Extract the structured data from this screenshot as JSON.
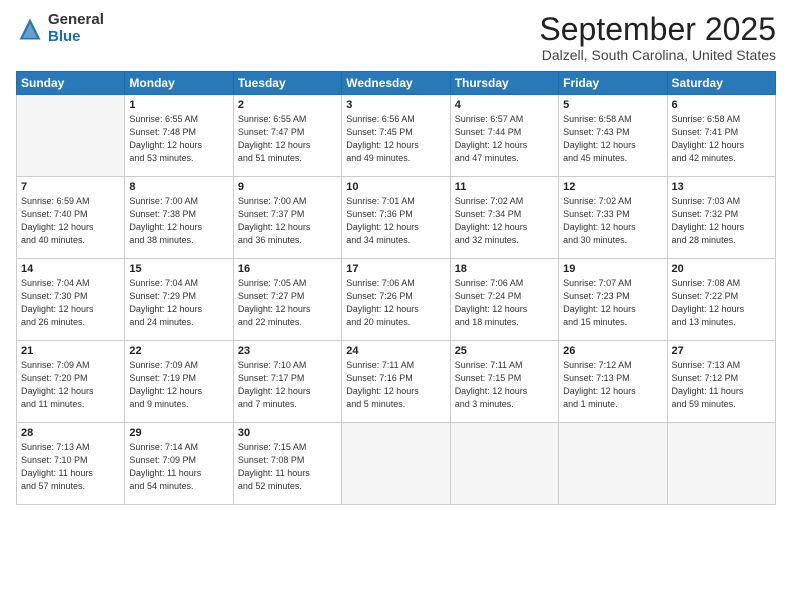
{
  "header": {
    "logo_general": "General",
    "logo_blue": "Blue",
    "month": "September 2025",
    "location": "Dalzell, South Carolina, United States"
  },
  "weekdays": [
    "Sunday",
    "Monday",
    "Tuesday",
    "Wednesday",
    "Thursday",
    "Friday",
    "Saturday"
  ],
  "weeks": [
    [
      {
        "day": "",
        "info": ""
      },
      {
        "day": "1",
        "info": "Sunrise: 6:55 AM\nSunset: 7:48 PM\nDaylight: 12 hours\nand 53 minutes."
      },
      {
        "day": "2",
        "info": "Sunrise: 6:55 AM\nSunset: 7:47 PM\nDaylight: 12 hours\nand 51 minutes."
      },
      {
        "day": "3",
        "info": "Sunrise: 6:56 AM\nSunset: 7:45 PM\nDaylight: 12 hours\nand 49 minutes."
      },
      {
        "day": "4",
        "info": "Sunrise: 6:57 AM\nSunset: 7:44 PM\nDaylight: 12 hours\nand 47 minutes."
      },
      {
        "day": "5",
        "info": "Sunrise: 6:58 AM\nSunset: 7:43 PM\nDaylight: 12 hours\nand 45 minutes."
      },
      {
        "day": "6",
        "info": "Sunrise: 6:58 AM\nSunset: 7:41 PM\nDaylight: 12 hours\nand 42 minutes."
      }
    ],
    [
      {
        "day": "7",
        "info": "Sunrise: 6:59 AM\nSunset: 7:40 PM\nDaylight: 12 hours\nand 40 minutes."
      },
      {
        "day": "8",
        "info": "Sunrise: 7:00 AM\nSunset: 7:38 PM\nDaylight: 12 hours\nand 38 minutes."
      },
      {
        "day": "9",
        "info": "Sunrise: 7:00 AM\nSunset: 7:37 PM\nDaylight: 12 hours\nand 36 minutes."
      },
      {
        "day": "10",
        "info": "Sunrise: 7:01 AM\nSunset: 7:36 PM\nDaylight: 12 hours\nand 34 minutes."
      },
      {
        "day": "11",
        "info": "Sunrise: 7:02 AM\nSunset: 7:34 PM\nDaylight: 12 hours\nand 32 minutes."
      },
      {
        "day": "12",
        "info": "Sunrise: 7:02 AM\nSunset: 7:33 PM\nDaylight: 12 hours\nand 30 minutes."
      },
      {
        "day": "13",
        "info": "Sunrise: 7:03 AM\nSunset: 7:32 PM\nDaylight: 12 hours\nand 28 minutes."
      }
    ],
    [
      {
        "day": "14",
        "info": "Sunrise: 7:04 AM\nSunset: 7:30 PM\nDaylight: 12 hours\nand 26 minutes."
      },
      {
        "day": "15",
        "info": "Sunrise: 7:04 AM\nSunset: 7:29 PM\nDaylight: 12 hours\nand 24 minutes."
      },
      {
        "day": "16",
        "info": "Sunrise: 7:05 AM\nSunset: 7:27 PM\nDaylight: 12 hours\nand 22 minutes."
      },
      {
        "day": "17",
        "info": "Sunrise: 7:06 AM\nSunset: 7:26 PM\nDaylight: 12 hours\nand 20 minutes."
      },
      {
        "day": "18",
        "info": "Sunrise: 7:06 AM\nSunset: 7:24 PM\nDaylight: 12 hours\nand 18 minutes."
      },
      {
        "day": "19",
        "info": "Sunrise: 7:07 AM\nSunset: 7:23 PM\nDaylight: 12 hours\nand 15 minutes."
      },
      {
        "day": "20",
        "info": "Sunrise: 7:08 AM\nSunset: 7:22 PM\nDaylight: 12 hours\nand 13 minutes."
      }
    ],
    [
      {
        "day": "21",
        "info": "Sunrise: 7:09 AM\nSunset: 7:20 PM\nDaylight: 12 hours\nand 11 minutes."
      },
      {
        "day": "22",
        "info": "Sunrise: 7:09 AM\nSunset: 7:19 PM\nDaylight: 12 hours\nand 9 minutes."
      },
      {
        "day": "23",
        "info": "Sunrise: 7:10 AM\nSunset: 7:17 PM\nDaylight: 12 hours\nand 7 minutes."
      },
      {
        "day": "24",
        "info": "Sunrise: 7:11 AM\nSunset: 7:16 PM\nDaylight: 12 hours\nand 5 minutes."
      },
      {
        "day": "25",
        "info": "Sunrise: 7:11 AM\nSunset: 7:15 PM\nDaylight: 12 hours\nand 3 minutes."
      },
      {
        "day": "26",
        "info": "Sunrise: 7:12 AM\nSunset: 7:13 PM\nDaylight: 12 hours\nand 1 minute."
      },
      {
        "day": "27",
        "info": "Sunrise: 7:13 AM\nSunset: 7:12 PM\nDaylight: 11 hours\nand 59 minutes."
      }
    ],
    [
      {
        "day": "28",
        "info": "Sunrise: 7:13 AM\nSunset: 7:10 PM\nDaylight: 11 hours\nand 57 minutes."
      },
      {
        "day": "29",
        "info": "Sunrise: 7:14 AM\nSunset: 7:09 PM\nDaylight: 11 hours\nand 54 minutes."
      },
      {
        "day": "30",
        "info": "Sunrise: 7:15 AM\nSunset: 7:08 PM\nDaylight: 11 hours\nand 52 minutes."
      },
      {
        "day": "",
        "info": ""
      },
      {
        "day": "",
        "info": ""
      },
      {
        "day": "",
        "info": ""
      },
      {
        "day": "",
        "info": ""
      }
    ]
  ]
}
